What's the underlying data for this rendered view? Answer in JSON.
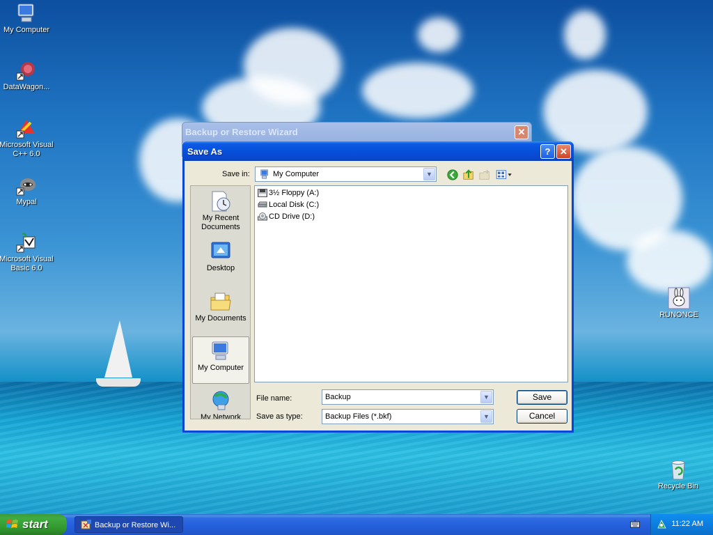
{
  "desktop": {
    "icons": [
      {
        "label": "My Computer"
      },
      {
        "label": "DataWagon..."
      },
      {
        "label": "Microsoft Visual C++ 6.0"
      },
      {
        "label": "Mypal"
      },
      {
        "label": "Microsoft Visual Basic 6.0"
      },
      {
        "label": "RUNONCE"
      },
      {
        "label": "Recycle Bin"
      }
    ]
  },
  "wizard": {
    "title": "Backup or Restore Wizard",
    "close_glyph": "✕"
  },
  "dialog": {
    "title": "Save As",
    "help_glyph": "?",
    "close_glyph": "✕",
    "save_in_label": "Save in:",
    "save_in_value": "My Computer",
    "places": [
      {
        "label": "My Recent Documents",
        "icon": "recent-documents-icon"
      },
      {
        "label": "Desktop",
        "icon": "desktop-icon"
      },
      {
        "label": "My Documents",
        "icon": "my-documents-icon"
      },
      {
        "label": "My Computer",
        "icon": "my-computer-icon",
        "selected": true
      },
      {
        "label": "My Network",
        "icon": "my-network-icon"
      }
    ],
    "files": [
      {
        "label": "3½ Floppy (A:)",
        "icon": "floppy-drive-icon"
      },
      {
        "label": "Local Disk (C:)",
        "icon": "hard-disk-icon"
      },
      {
        "label": "CD Drive (D:)",
        "icon": "cd-drive-icon"
      }
    ],
    "file_name_label": "File name:",
    "file_name_value": "Backup",
    "save_as_type_label": "Save as type:",
    "save_as_type_value": "Backup Files (*.bkf)",
    "save_label": "Save",
    "cancel_label": "Cancel"
  },
  "taskbar": {
    "start_label": "start",
    "task_label": "Backup or Restore Wi...",
    "clock": "11:22 AM"
  },
  "colors": {
    "title_bar": "#0a48ce",
    "start_button": "#3fac3f",
    "taskbar": "#245edb"
  }
}
